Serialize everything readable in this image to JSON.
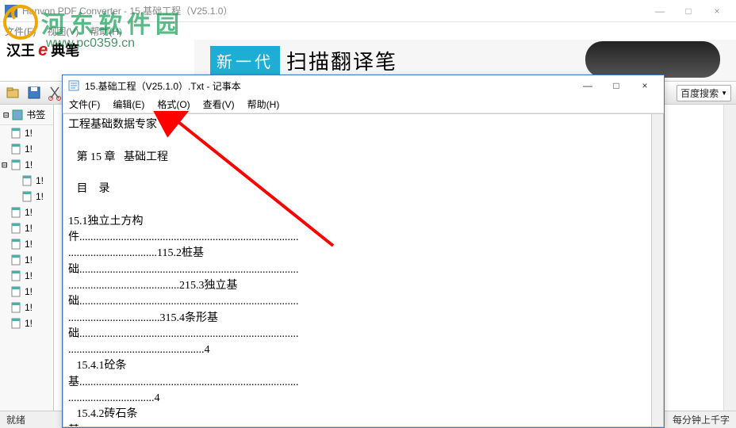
{
  "watermark": {
    "brand": "河东软件园",
    "url": "www.pc0359.cn"
  },
  "main_window": {
    "title": "Hanvon PDF Converter - 15.基础工程（V25.1.0）",
    "menus": [
      "文件(F)",
      "视图(V)",
      "帮助(H)"
    ],
    "window_controls": {
      "min": "—",
      "max": "□",
      "close": "×"
    }
  },
  "banner": {
    "brand_a": "汉王",
    "brand_e": "e",
    "brand_b": "典笔",
    "tag": "新一代",
    "pen_label": "扫描翻译笔"
  },
  "toolbar": {
    "search_label": "百度搜索",
    "icons": [
      "open",
      "save",
      "print",
      "settings",
      "page"
    ]
  },
  "sidebar": {
    "root_label": "书签",
    "items": [
      "1!",
      "1!",
      "1!",
      "1!",
      "1!",
      "1!",
      "1!",
      "1!",
      "1!",
      "1!",
      "1!",
      "1!",
      "1!"
    ]
  },
  "status": {
    "left": "就绪",
    "right": "每分钟上千字"
  },
  "notepad": {
    "title": "15.基础工程（V25.1.0）.Txt - 记事本",
    "menus": [
      "文件(F)",
      "编辑(E)",
      "格式(O)",
      "查看(V)",
      "帮助(H)"
    ],
    "window_controls": {
      "min": "—",
      "max": "□",
      "close": "×"
    },
    "lines": [
      "工程基础数据专家",
      "",
      "   第 15 章   基础工程",
      "",
      "   目    录",
      "",
      "15.1独立土方构",
      "件...............................................................................",
      "................................115.2桩基",
      "础...............................................................................",
      "........................................215.3独立基",
      "础...............................................................................",
      ".................................315.4条形基",
      "础...............................................................................",
      ".................................................4",
      "   15.4.1砼条",
      "基...............................................................................",
      "...............................4",
      "   15.4.2砖石条",
      "基..............................................................................."
    ]
  },
  "annotation": {
    "arrow_color": "#ff0000"
  }
}
